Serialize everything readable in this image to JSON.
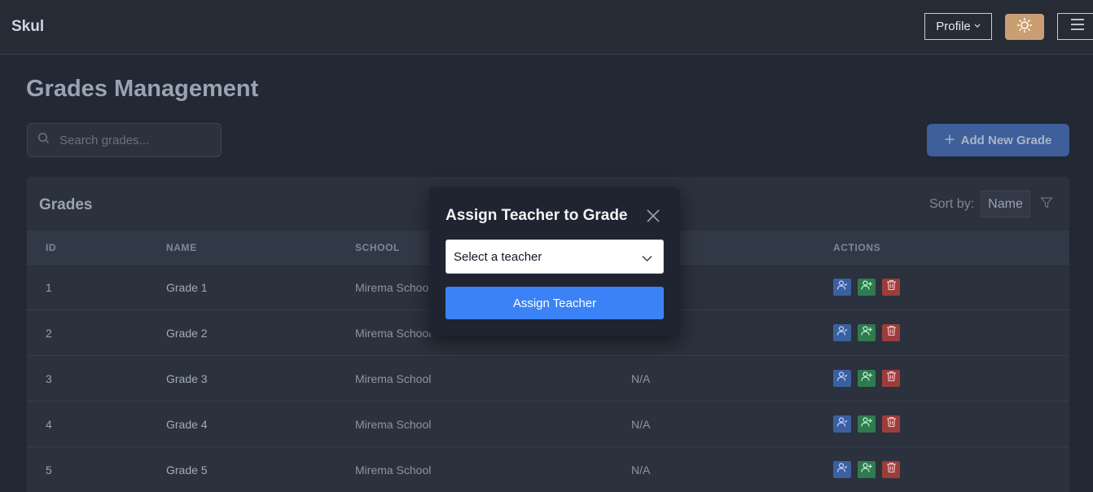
{
  "navbar": {
    "brand": "Skul",
    "profile_label": "Profile",
    "theme_icon": "sun-icon",
    "menu_icon": "hamburger-icon"
  },
  "page": {
    "title": "Grades Management",
    "search_placeholder": "Search grades...",
    "add_button_label": "Add New Grade"
  },
  "card": {
    "title": "Grades",
    "sort_label": "Sort by:",
    "sort_value": "Name"
  },
  "table": {
    "headers": {
      "id": "ID",
      "name": "NAME",
      "school": "SCHOOL",
      "actions": "ACTIONS"
    },
    "rows": [
      {
        "id": "1",
        "name": "Grade 1",
        "school": "Mirema School",
        "teacher": ""
      },
      {
        "id": "2",
        "name": "Grade 2",
        "school": "Mirema School",
        "teacher": ""
      },
      {
        "id": "3",
        "name": "Grade 3",
        "school": "Mirema School",
        "teacher": "N/A"
      },
      {
        "id": "4",
        "name": "Grade 4",
        "school": "Mirema School",
        "teacher": "N/A"
      },
      {
        "id": "5",
        "name": "Grade 5",
        "school": "Mirema School",
        "teacher": "N/A"
      }
    ]
  },
  "modal": {
    "title": "Assign Teacher to Grade",
    "select_value": "Select a teacher",
    "assign_button_label": "Assign Teacher"
  },
  "colors": {
    "primary": "#3b82f6",
    "theme_button": "#c99e72",
    "action_blue": "#3b60a0",
    "action_green": "#2f7a4f",
    "action_red": "#9c3d3d"
  }
}
